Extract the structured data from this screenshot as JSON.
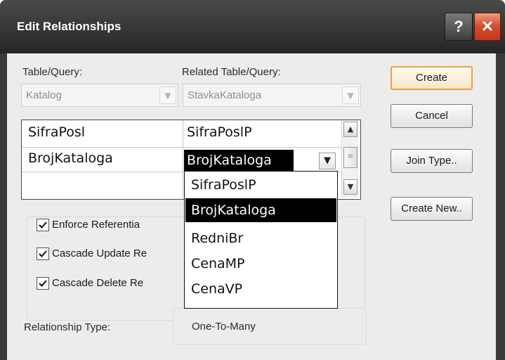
{
  "window": {
    "title": "Edit Relationships",
    "help_label": "?",
    "close_label": "✕"
  },
  "table_query": {
    "label": "Table/Query:",
    "value": "Katalog"
  },
  "related_table_query": {
    "label": "Related Table/Query:",
    "value": "StavkaKataloga"
  },
  "grid": {
    "rows": [
      {
        "left": "SifraPosl",
        "right": "SifraPoslP"
      },
      {
        "left": "BrojKataloga",
        "right": "BrojKataloga"
      },
      {
        "left": "",
        "right": ""
      }
    ]
  },
  "dropdown": {
    "items": [
      "SifraPoslP",
      "BrojKataloga",
      "RedniBr",
      "CenaMP",
      "CenaVP"
    ],
    "selected": "BrojKataloga"
  },
  "options": {
    "enforce_label": "Enforce Referentia",
    "enforce_checked": true,
    "cascade_update_label": "Cascade Update Re",
    "cascade_update_checked": true,
    "cascade_delete_label": "Cascade Delete Re",
    "cascade_delete_checked": true
  },
  "relationship_type": {
    "label": "Relationship Type:",
    "value": "One-To-Many"
  },
  "buttons": {
    "create": "Create",
    "cancel": "Cancel",
    "join_type": "Join Type..",
    "create_new": "Create New.."
  },
  "colors": {
    "title_bar": "#2e2e2e",
    "close_button": "#d24a2a",
    "default_button_border": "#f0a040",
    "selection": "#000000"
  }
}
